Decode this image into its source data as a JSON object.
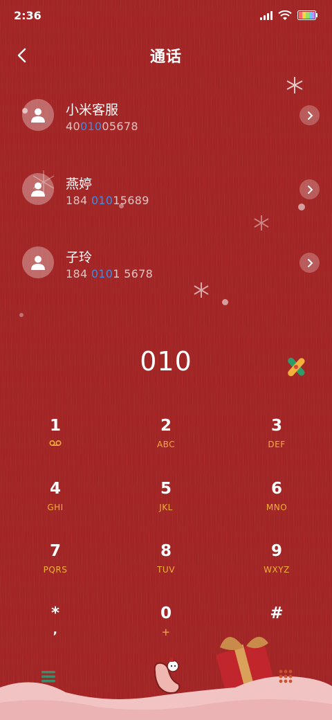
{
  "status_bar": {
    "time": "2:36"
  },
  "header": {
    "title": "通话"
  },
  "contacts": [
    {
      "name": "小米客服",
      "number_pre": "40",
      "number_match": "010",
      "number_post": "05678"
    },
    {
      "name": "燕婷",
      "number_pre": "184 ",
      "number_match": "010",
      "number_post": "15689"
    },
    {
      "name": "子玲",
      "number_pre": "184 ",
      "number_match": "010",
      "number_post": "1 5678"
    }
  ],
  "dialer": {
    "number": "010"
  },
  "keypad": [
    {
      "digit": "1",
      "letters": ""
    },
    {
      "digit": "2",
      "letters": "ABC"
    },
    {
      "digit": "3",
      "letters": "DEF"
    },
    {
      "digit": "4",
      "letters": "GHI"
    },
    {
      "digit": "5",
      "letters": "JKL"
    },
    {
      "digit": "6",
      "letters": "MNO"
    },
    {
      "digit": "7",
      "letters": "PQRS"
    },
    {
      "digit": "8",
      "letters": "TUV"
    },
    {
      "digit": "9",
      "letters": "WXYZ"
    },
    {
      "digit": "*",
      "letters": ","
    },
    {
      "digit": "0",
      "letters": "+"
    },
    {
      "digit": "#",
      "letters": ""
    }
  ],
  "colors": {
    "background": "#a42626",
    "match_highlight": "#3b8de8",
    "key_letters": "#f2b13b"
  },
  "icons": {
    "back": "chevron-left-icon",
    "contact_avatar": "person-icon",
    "detail": "chevron-right-icon",
    "clear": "clear-icon",
    "voicemail": "voicemail-icon",
    "menu": "menu-icon",
    "call": "call-icon",
    "dialpad": "dialpad-icon"
  }
}
